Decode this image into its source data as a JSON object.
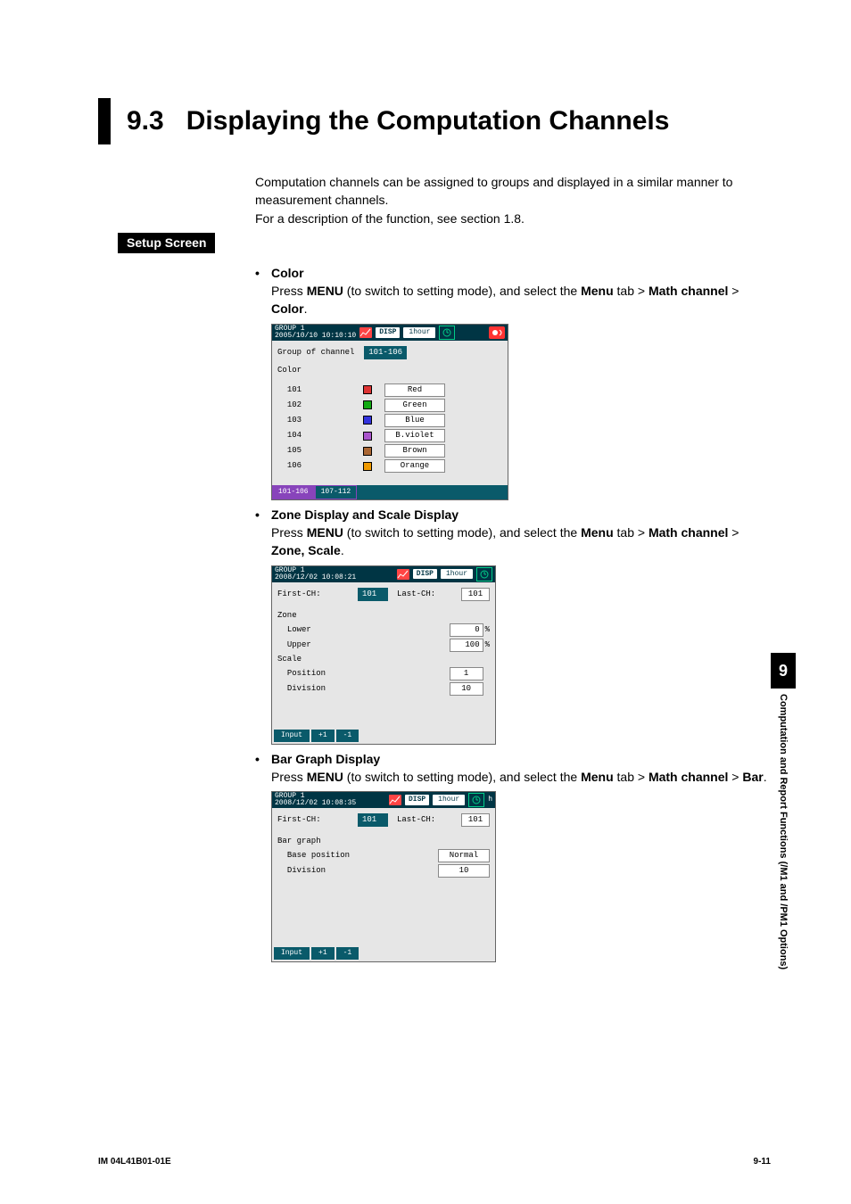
{
  "section_number": "9.3",
  "section_title": "Displaying the Computation Channels",
  "intro_p1": "Computation channels can be assigned to groups and displayed in a similar manner to measurement channels.",
  "intro_p2": "For a description of the function, see section 1.8.",
  "setup_screen_label": "Setup Screen",
  "bullets": {
    "color": {
      "title": "Color",
      "press_pre": "Press ",
      "menu": "MENU",
      "press_mid": " (to switch to setting mode), and select the ",
      "menu_tab": "Menu",
      "press_tab": " tab > ",
      "math_channel": "Math channel",
      "press_end_gt": " > ",
      "endword": "Color",
      "period": "."
    },
    "zone": {
      "title": "Zone Display and Scale Display",
      "endword": "Zone, Scale"
    },
    "bar": {
      "title": "Bar Graph Display",
      "endword": "Bar"
    }
  },
  "shot_common": {
    "group": "GROUP 1",
    "disp": "DISP",
    "time_pill": "1hour"
  },
  "shot_color": {
    "timestamp": "2005/10/10 10:10:10",
    "group_of_channel_label": "Group of channel",
    "group_of_channel_val": "101-106",
    "color_label": "Color",
    "rows": [
      {
        "ch": "101",
        "name": "Red",
        "hex": "#d33"
      },
      {
        "ch": "102",
        "name": "Green",
        "hex": "#1a1"
      },
      {
        "ch": "103",
        "name": "Blue",
        "hex": "#33d"
      },
      {
        "ch": "104",
        "name": "B.violet",
        "hex": "#a5c"
      },
      {
        "ch": "105",
        "name": "Brown",
        "hex": "#a63"
      },
      {
        "ch": "106",
        "name": "Orange",
        "hex": "#e90"
      }
    ],
    "tabs": [
      "101-106",
      "107-112"
    ]
  },
  "shot_zone": {
    "timestamp": "2008/12/02 10:08:21",
    "first_ch_label": "First-CH:",
    "first_ch_val": "101",
    "last_ch_label": "Last-CH:",
    "last_ch_val": "101",
    "zone_label": "Zone",
    "lower_label": "Lower",
    "lower_val": "0",
    "upper_label": "Upper",
    "upper_val": "100",
    "pct": "%",
    "scale_label": "Scale",
    "position_label": "Position",
    "position_val": "1",
    "division_label": "Division",
    "division_val": "10",
    "soft": [
      "Input",
      "+1",
      "-1"
    ]
  },
  "shot_bar": {
    "timestamp": "2008/12/02 10:08:35",
    "first_ch_label": "First-CH:",
    "first_ch_val": "101",
    "last_ch_label": "Last-CH:",
    "last_ch_val": "101",
    "bargraph_label": "Bar graph",
    "basepos_label": "Base position",
    "basepos_val": "Normal",
    "division_label": "Division",
    "division_val": "10",
    "soft": [
      "Input",
      "+1",
      "-1"
    ]
  },
  "side": {
    "num": "9",
    "text": "Computation and Report Functions (/M1 and /PM1 Options)"
  },
  "footer": {
    "left": "IM 04L41B01-01E",
    "right": "9-11"
  }
}
